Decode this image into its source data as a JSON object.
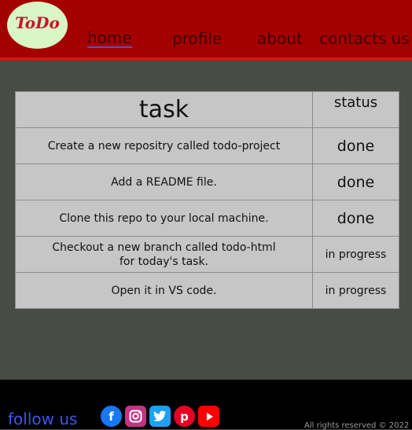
{
  "header": {
    "logo": "ToDo",
    "nav": [
      "home",
      "profile",
      "about",
      "contacts us"
    ]
  },
  "table": {
    "headers": [
      "task",
      "status"
    ],
    "rows": [
      {
        "task": "Create a new repositry called todo-project",
        "status": "done"
      },
      {
        "task": "Add a README file.",
        "status": "done"
      },
      {
        "task": "Clone this repo to your local machine.",
        "status": "done"
      },
      {
        "task": "Checkout a new branch called todo-html for today's task.",
        "status": "in progress"
      },
      {
        "task": "Open it in VS code.",
        "status": "in progress"
      }
    ]
  },
  "footer": {
    "follow": "follow us",
    "social": [
      "facebook-icon",
      "instagram-icon",
      "twitter-icon",
      "pinterest-icon",
      "youtube-icon"
    ],
    "rights": "All rights reserved © 2022"
  },
  "colors": {
    "header": "#a50000",
    "page": "#494b45",
    "footer": "#000000",
    "follow": "#3a58f0"
  }
}
